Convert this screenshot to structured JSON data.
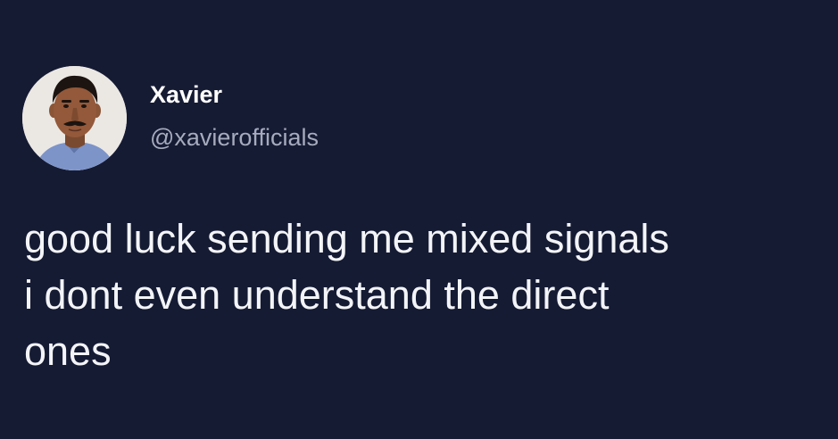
{
  "tweet": {
    "author": {
      "display_name": "Xavier",
      "handle": "@xavierofficials",
      "avatar_icon": "profile-photo"
    },
    "text_lines": [
      "good luck sending me mixed signals",
      "i dont even understand the direct",
      "ones"
    ]
  },
  "colors": {
    "background": "#161b34",
    "name": "#ffffff",
    "handle": "#a6abbd",
    "text": "#f3f4f7"
  }
}
